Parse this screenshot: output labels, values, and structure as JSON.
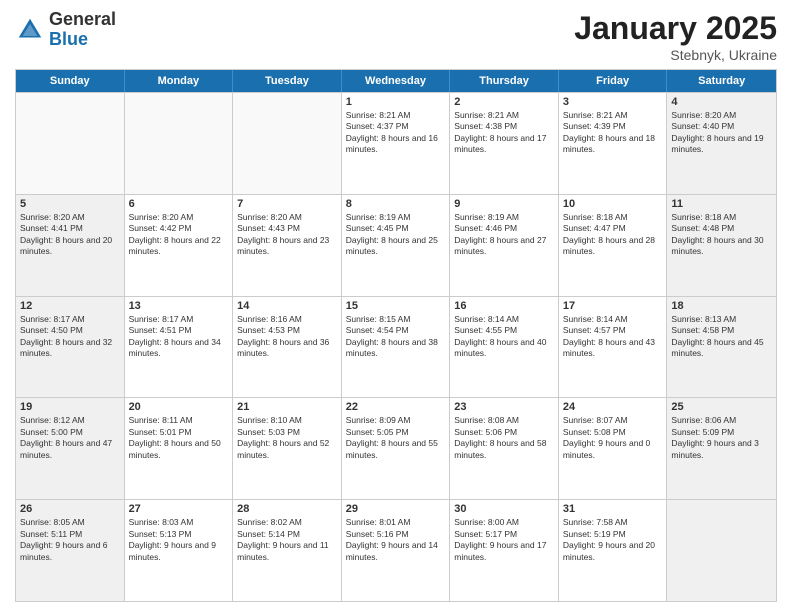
{
  "header": {
    "logo_general": "General",
    "logo_blue": "Blue",
    "month_title": "January 2025",
    "subtitle": "Stebnyk, Ukraine"
  },
  "days_of_week": [
    "Sunday",
    "Monday",
    "Tuesday",
    "Wednesday",
    "Thursday",
    "Friday",
    "Saturday"
  ],
  "rows": [
    [
      {
        "day": "",
        "empty": true
      },
      {
        "day": "",
        "empty": true
      },
      {
        "day": "",
        "empty": true
      },
      {
        "day": "1",
        "sunrise": "Sunrise: 8:21 AM",
        "sunset": "Sunset: 4:37 PM",
        "daylight": "Daylight: 8 hours and 16 minutes."
      },
      {
        "day": "2",
        "sunrise": "Sunrise: 8:21 AM",
        "sunset": "Sunset: 4:38 PM",
        "daylight": "Daylight: 8 hours and 17 minutes."
      },
      {
        "day": "3",
        "sunrise": "Sunrise: 8:21 AM",
        "sunset": "Sunset: 4:39 PM",
        "daylight": "Daylight: 8 hours and 18 minutes."
      },
      {
        "day": "4",
        "sunrise": "Sunrise: 8:20 AM",
        "sunset": "Sunset: 4:40 PM",
        "daylight": "Daylight: 8 hours and 19 minutes.",
        "shaded": true
      }
    ],
    [
      {
        "day": "5",
        "sunrise": "Sunrise: 8:20 AM",
        "sunset": "Sunset: 4:41 PM",
        "daylight": "Daylight: 8 hours and 20 minutes.",
        "shaded": true
      },
      {
        "day": "6",
        "sunrise": "Sunrise: 8:20 AM",
        "sunset": "Sunset: 4:42 PM",
        "daylight": "Daylight: 8 hours and 22 minutes."
      },
      {
        "day": "7",
        "sunrise": "Sunrise: 8:20 AM",
        "sunset": "Sunset: 4:43 PM",
        "daylight": "Daylight: 8 hours and 23 minutes."
      },
      {
        "day": "8",
        "sunrise": "Sunrise: 8:19 AM",
        "sunset": "Sunset: 4:45 PM",
        "daylight": "Daylight: 8 hours and 25 minutes."
      },
      {
        "day": "9",
        "sunrise": "Sunrise: 8:19 AM",
        "sunset": "Sunset: 4:46 PM",
        "daylight": "Daylight: 8 hours and 27 minutes."
      },
      {
        "day": "10",
        "sunrise": "Sunrise: 8:18 AM",
        "sunset": "Sunset: 4:47 PM",
        "daylight": "Daylight: 8 hours and 28 minutes."
      },
      {
        "day": "11",
        "sunrise": "Sunrise: 8:18 AM",
        "sunset": "Sunset: 4:48 PM",
        "daylight": "Daylight: 8 hours and 30 minutes.",
        "shaded": true
      }
    ],
    [
      {
        "day": "12",
        "sunrise": "Sunrise: 8:17 AM",
        "sunset": "Sunset: 4:50 PM",
        "daylight": "Daylight: 8 hours and 32 minutes.",
        "shaded": true
      },
      {
        "day": "13",
        "sunrise": "Sunrise: 8:17 AM",
        "sunset": "Sunset: 4:51 PM",
        "daylight": "Daylight: 8 hours and 34 minutes."
      },
      {
        "day": "14",
        "sunrise": "Sunrise: 8:16 AM",
        "sunset": "Sunset: 4:53 PM",
        "daylight": "Daylight: 8 hours and 36 minutes."
      },
      {
        "day": "15",
        "sunrise": "Sunrise: 8:15 AM",
        "sunset": "Sunset: 4:54 PM",
        "daylight": "Daylight: 8 hours and 38 minutes."
      },
      {
        "day": "16",
        "sunrise": "Sunrise: 8:14 AM",
        "sunset": "Sunset: 4:55 PM",
        "daylight": "Daylight: 8 hours and 40 minutes."
      },
      {
        "day": "17",
        "sunrise": "Sunrise: 8:14 AM",
        "sunset": "Sunset: 4:57 PM",
        "daylight": "Daylight: 8 hours and 43 minutes."
      },
      {
        "day": "18",
        "sunrise": "Sunrise: 8:13 AM",
        "sunset": "Sunset: 4:58 PM",
        "daylight": "Daylight: 8 hours and 45 minutes.",
        "shaded": true
      }
    ],
    [
      {
        "day": "19",
        "sunrise": "Sunrise: 8:12 AM",
        "sunset": "Sunset: 5:00 PM",
        "daylight": "Daylight: 8 hours and 47 minutes.",
        "shaded": true
      },
      {
        "day": "20",
        "sunrise": "Sunrise: 8:11 AM",
        "sunset": "Sunset: 5:01 PM",
        "daylight": "Daylight: 8 hours and 50 minutes."
      },
      {
        "day": "21",
        "sunrise": "Sunrise: 8:10 AM",
        "sunset": "Sunset: 5:03 PM",
        "daylight": "Daylight: 8 hours and 52 minutes."
      },
      {
        "day": "22",
        "sunrise": "Sunrise: 8:09 AM",
        "sunset": "Sunset: 5:05 PM",
        "daylight": "Daylight: 8 hours and 55 minutes."
      },
      {
        "day": "23",
        "sunrise": "Sunrise: 8:08 AM",
        "sunset": "Sunset: 5:06 PM",
        "daylight": "Daylight: 8 hours and 58 minutes."
      },
      {
        "day": "24",
        "sunrise": "Sunrise: 8:07 AM",
        "sunset": "Sunset: 5:08 PM",
        "daylight": "Daylight: 9 hours and 0 minutes."
      },
      {
        "day": "25",
        "sunrise": "Sunrise: 8:06 AM",
        "sunset": "Sunset: 5:09 PM",
        "daylight": "Daylight: 9 hours and 3 minutes.",
        "shaded": true
      }
    ],
    [
      {
        "day": "26",
        "sunrise": "Sunrise: 8:05 AM",
        "sunset": "Sunset: 5:11 PM",
        "daylight": "Daylight: 9 hours and 6 minutes.",
        "shaded": true
      },
      {
        "day": "27",
        "sunrise": "Sunrise: 8:03 AM",
        "sunset": "Sunset: 5:13 PM",
        "daylight": "Daylight: 9 hours and 9 minutes."
      },
      {
        "day": "28",
        "sunrise": "Sunrise: 8:02 AM",
        "sunset": "Sunset: 5:14 PM",
        "daylight": "Daylight: 9 hours and 11 minutes."
      },
      {
        "day": "29",
        "sunrise": "Sunrise: 8:01 AM",
        "sunset": "Sunset: 5:16 PM",
        "daylight": "Daylight: 9 hours and 14 minutes."
      },
      {
        "day": "30",
        "sunrise": "Sunrise: 8:00 AM",
        "sunset": "Sunset: 5:17 PM",
        "daylight": "Daylight: 9 hours and 17 minutes."
      },
      {
        "day": "31",
        "sunrise": "Sunrise: 7:58 AM",
        "sunset": "Sunset: 5:19 PM",
        "daylight": "Daylight: 9 hours and 20 minutes."
      },
      {
        "day": "",
        "empty": true,
        "shaded": true
      }
    ]
  ]
}
